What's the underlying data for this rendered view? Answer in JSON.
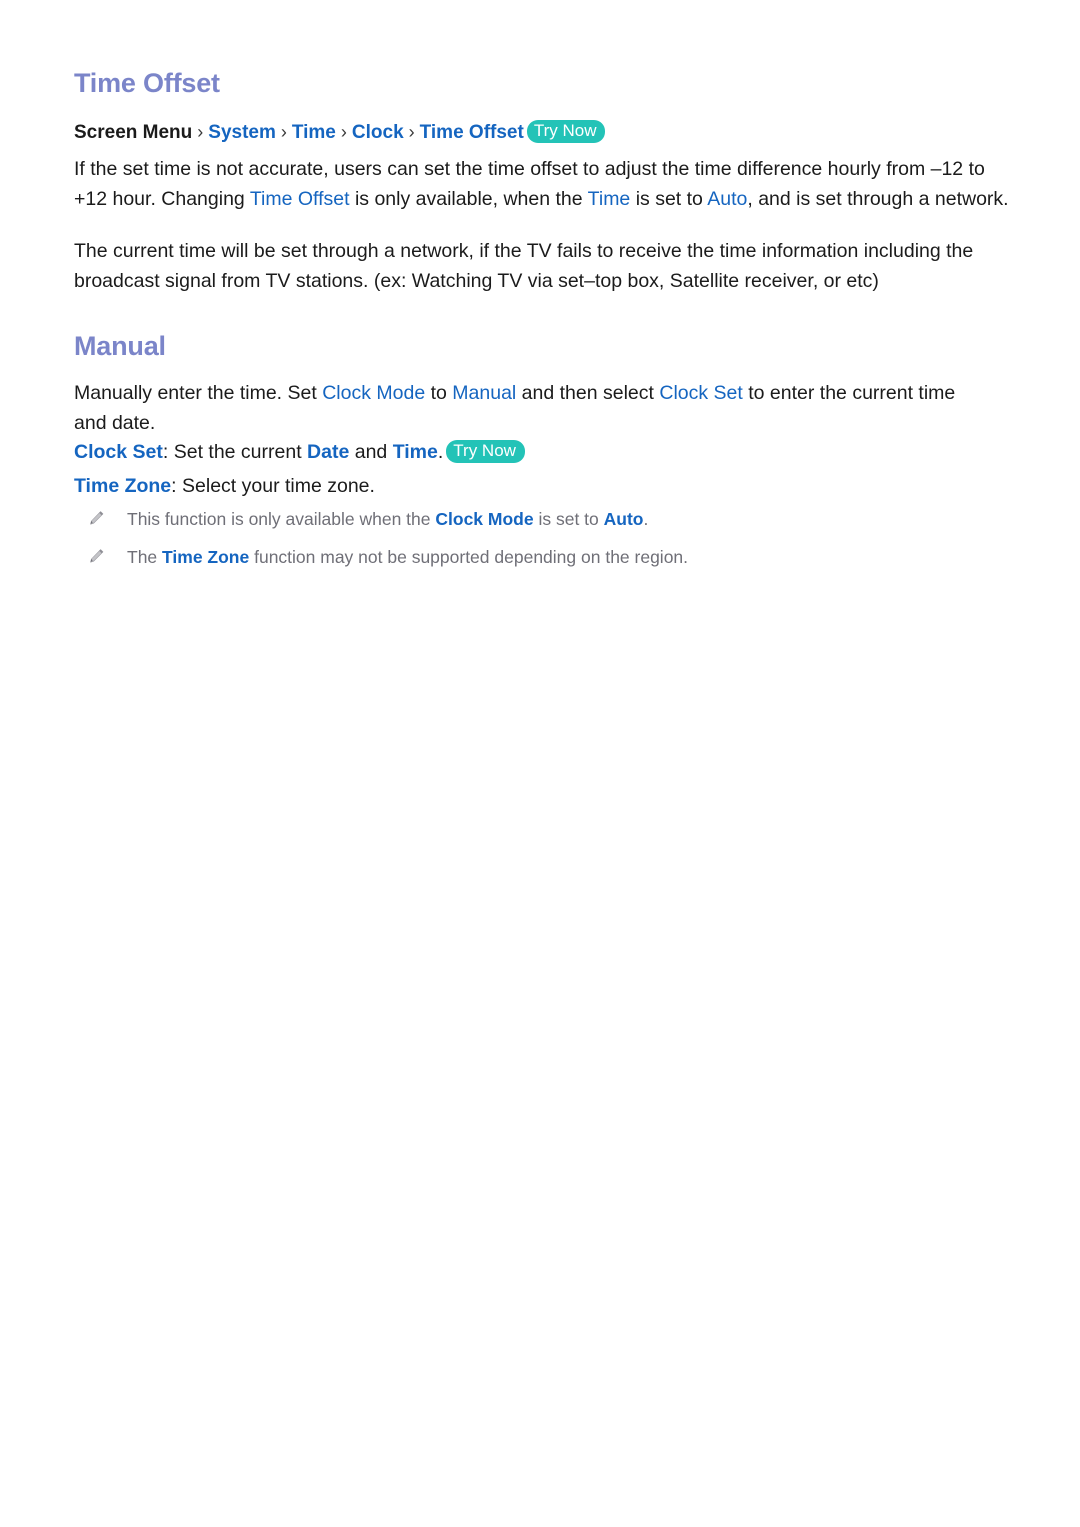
{
  "document": {
    "background_color": "#ffffff",
    "heading_color": "#7b85c9",
    "link_color": "#1565c0",
    "body_color": "#1b1b1b",
    "note_color": "#6f6f77",
    "badge_color": "#23c3b7"
  },
  "sections": {
    "time_offset": {
      "title": "Time Offset",
      "breadcrumb": {
        "root": "Screen Menu",
        "separator": "›",
        "items": [
          "System",
          "Time",
          "Clock",
          "Time Offset"
        ],
        "badge": "Try Now"
      },
      "paragraph_1": {
        "part_1": "If the set time is not accurate, users can set the time offset to adjust the time difference hourly from –12 to +12 hour. Changing ",
        "kw_1": "Time Offset",
        "part_2": " is only available, when the ",
        "kw_2": "Time",
        "part_3": " is set to ",
        "kw_3": "Auto",
        "part_4": ", and is set through a network."
      },
      "paragraph_2": "The current time will be set through a network, if the TV fails to receive the time information including the broadcast signal from TV stations. (ex: Watching TV via set–top box, Satellite receiver, or etc)"
    },
    "manual": {
      "title": "Manual",
      "paragraph_1": {
        "part_1": "Manually enter the time. Set ",
        "kw_1": "Clock Mode",
        "part_2": " to ",
        "kw_2": "Manual",
        "part_3": " and then select ",
        "kw_3": "Clock Set",
        "part_4": " to enter the current time and date."
      },
      "definitions": [
        {
          "label": "Clock Set",
          "colon": ": ",
          "text_1": "Set the current ",
          "kw_1": "Date",
          "text_2": " and ",
          "kw_2": "Time",
          "text_3": ".",
          "badge": "Try Now"
        },
        {
          "label": "Time Zone",
          "colon": ": ",
          "text_1": "Select your time zone.",
          "kw_1": "",
          "text_2": "",
          "kw_2": "",
          "text_3": "",
          "badge": ""
        }
      ],
      "notes": [
        {
          "icon": "pencil-icon",
          "text_1": "This function is only available when the ",
          "kw_1": "Clock Mode",
          "text_2": " is set to ",
          "kw_2": "Auto",
          "text_3": "."
        },
        {
          "icon": "pencil-icon",
          "text_1": "The ",
          "kw_1": "Time Zone",
          "text_2": " function may not be supported depending on the region.",
          "kw_2": "",
          "text_3": ""
        }
      ]
    }
  }
}
